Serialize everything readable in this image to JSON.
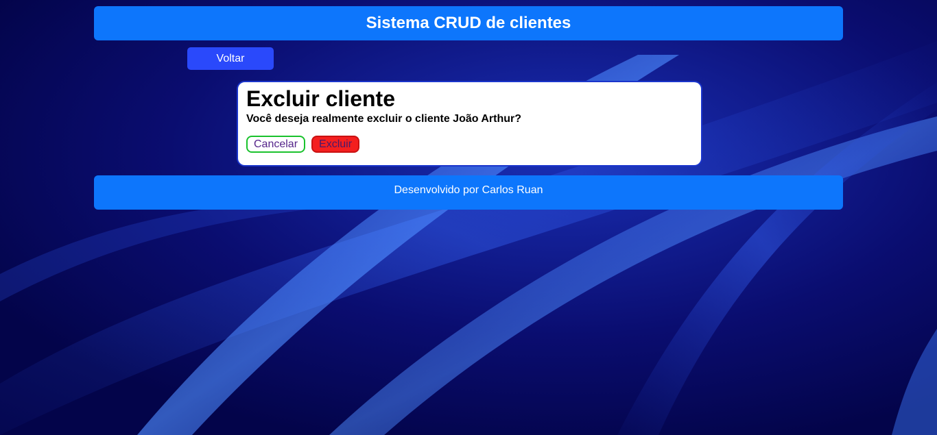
{
  "header": {
    "title": "Sistema CRUD de clientes"
  },
  "nav": {
    "back_label": "Voltar"
  },
  "dialog": {
    "title": "Excluir cliente",
    "message": "Você deseja realmente excluir o cliente João Arthur?",
    "cancel_label": "Cancelar",
    "delete_label": "Excluir"
  },
  "footer": {
    "text": "Desenvolvido por Carlos Ruan"
  },
  "colors": {
    "background": "#05064a",
    "header": "#0d76fc",
    "back_button": "#2a49fb",
    "cancel_border": "#19c22c",
    "delete_bg": "#f41f1f"
  }
}
